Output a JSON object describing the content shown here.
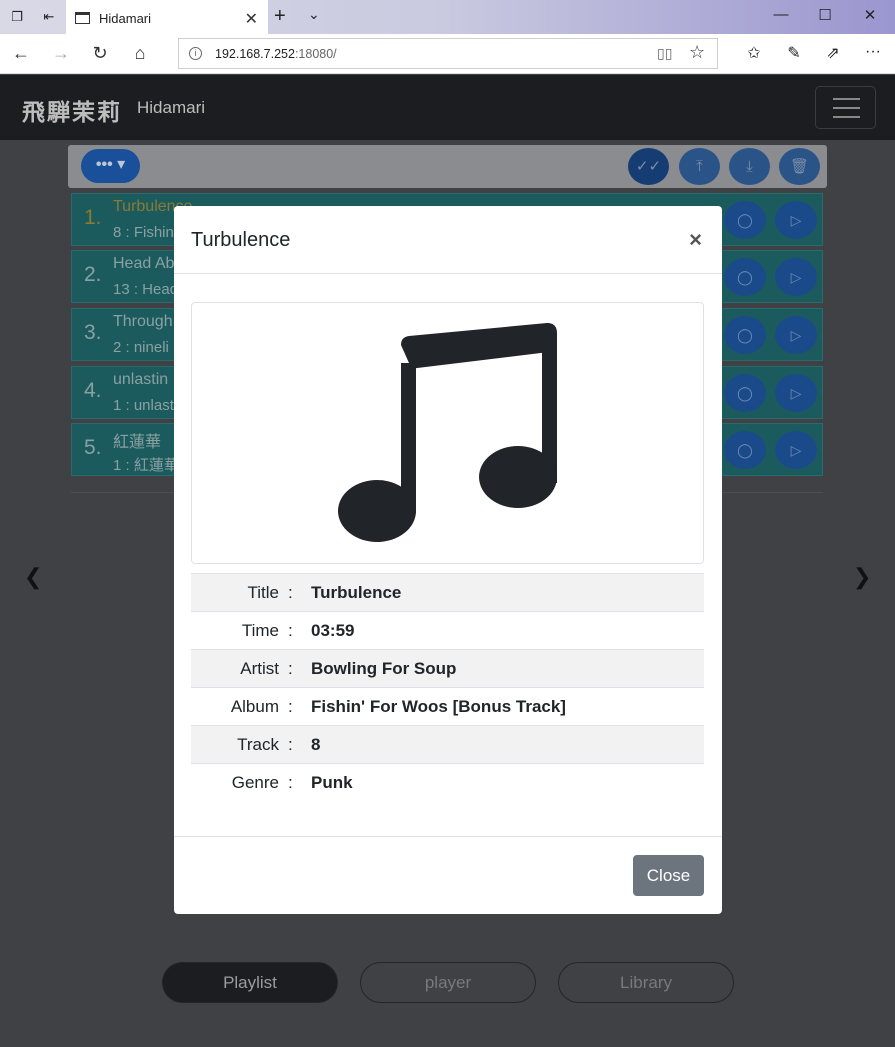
{
  "browser": {
    "tab_title": "Hidamari",
    "url_host": "192.168.7.252",
    "url_port": ":18080/"
  },
  "app": {
    "brand_logo": "飛騨茉莉",
    "brand_name": "Hidamari"
  },
  "playlist": {
    "items": [
      {
        "num": "1.",
        "title": "Turbulence",
        "sub": "8 : Fishin"
      },
      {
        "num": "2.",
        "title": "Head Ab",
        "sub": "13 : Head"
      },
      {
        "num": "3.",
        "title": "Through",
        "sub": "2 : nineli"
      },
      {
        "num": "4.",
        "title": "unlastin",
        "sub": "1 : unlast"
      },
      {
        "num": "5.",
        "title": "紅蓮華",
        "sub": "1 : 紅蓮華"
      }
    ]
  },
  "bottom_nav": {
    "playlist": "Playlist",
    "player": "player",
    "library": "Library"
  },
  "modal": {
    "title": "Turbulence",
    "close_label": "Close",
    "fields": [
      {
        "key": "Title",
        "value": "Turbulence"
      },
      {
        "key": "Time",
        "value": "03:59"
      },
      {
        "key": "Artist",
        "value": "Bowling For Soup"
      },
      {
        "key": "Album",
        "value": "Fishin' For Woos [Bonus Track]"
      },
      {
        "key": "Track",
        "value": "8"
      },
      {
        "key": "Genre",
        "value": "Punk"
      }
    ],
    "separator": ":"
  },
  "colors": {
    "navbar": "#1b1d20",
    "row": "#1b5b5e",
    "close_button": "#6c757d"
  }
}
